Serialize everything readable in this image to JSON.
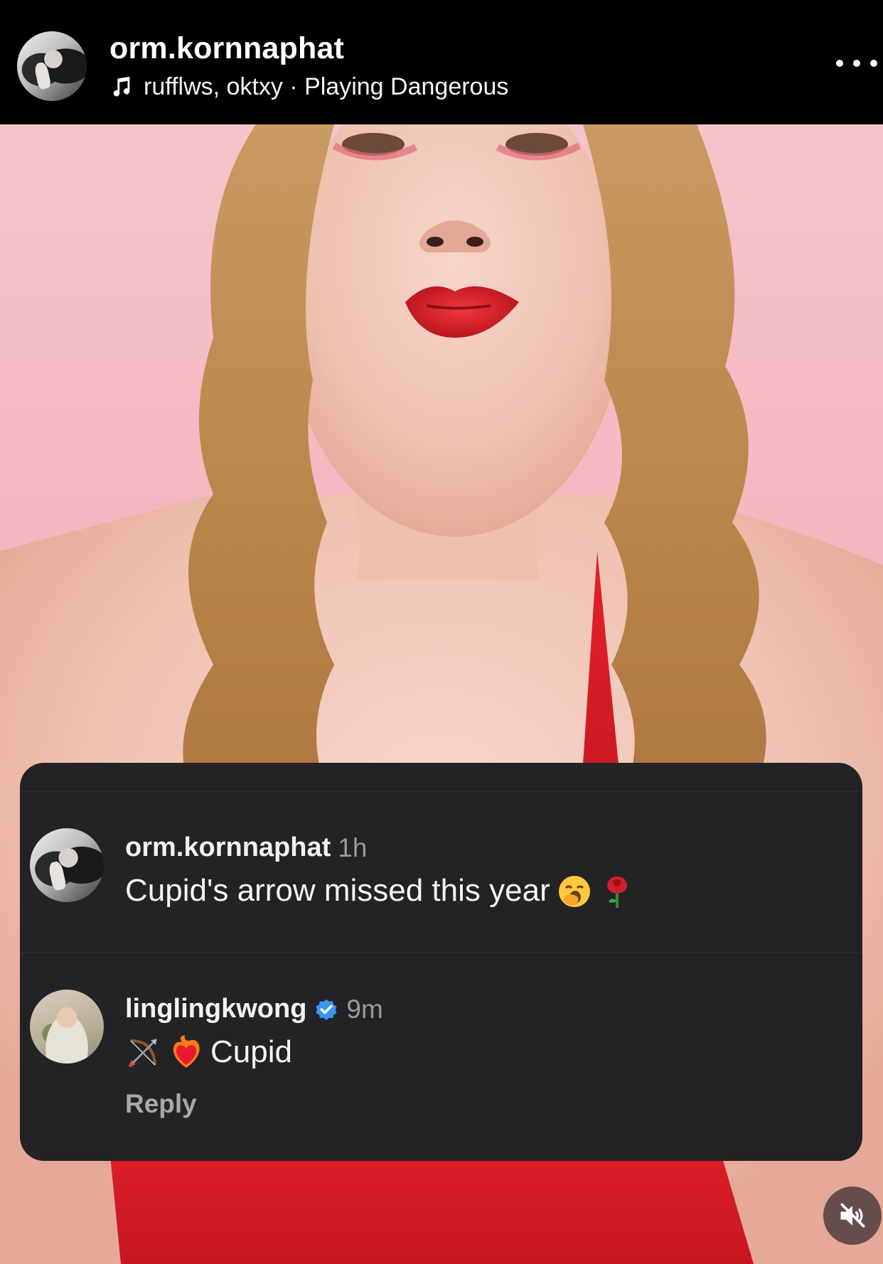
{
  "header": {
    "username": "orm.kornnaphat",
    "music_text": "rufflws, oktxy · Playing Dangerous",
    "music_icon": "music-note-icon",
    "more_icon": "more-options-icon"
  },
  "comments": [
    {
      "username": "orm.kornnaphat",
      "time": "1h",
      "text": "Cupid's arrow missed this year",
      "emojis": [
        "yawning-face-emoji",
        "rose-emoji"
      ]
    },
    {
      "username": "linglingkwong",
      "verified": true,
      "time": "9m",
      "emojis_before": [
        "bow-and-arrow-emoji",
        "heart-on-fire-emoji"
      ],
      "text": "Cupid",
      "reply_label": "Reply"
    }
  ],
  "colors": {
    "header_bg": "#000000",
    "panel_bg": "#232325",
    "verified_blue": "#3897f0",
    "muted_text": "#9a9a9d"
  },
  "mute_icon": "speaker-muted-icon"
}
